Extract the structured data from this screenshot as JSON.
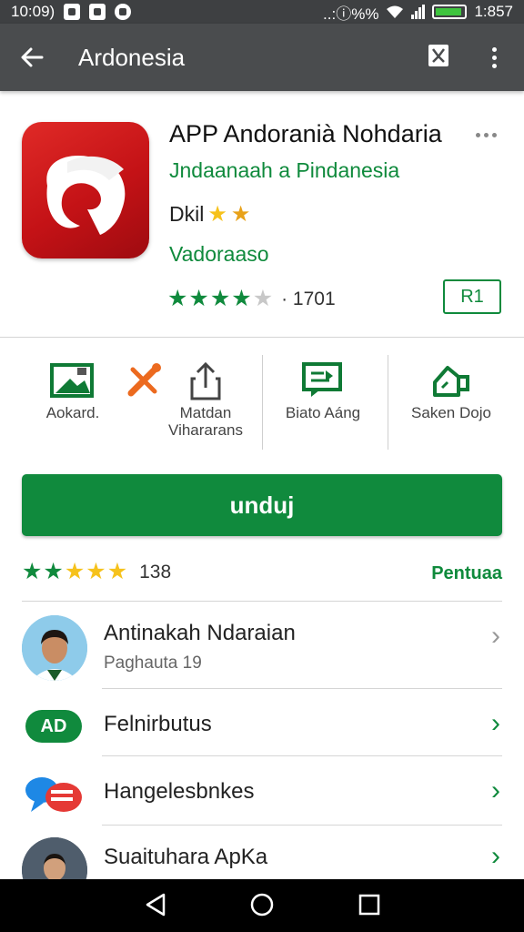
{
  "status_bar": {
    "time_left": "10:09)",
    "indicators": "..:ⓘ%%",
    "time_right": "1:857"
  },
  "app_bar": {
    "title": "Ardonesia",
    "back_icon": "back-arrow-icon",
    "bookmark_icon": "bookmark-icon",
    "more_icon": "more-vertical-icon"
  },
  "app": {
    "name": "APP Andoranià Nohdaria",
    "developer": "Jndaanaah a Pindanesia",
    "content_label": "Dkil",
    "category": "Vadoraaso",
    "rating_stars": 4,
    "rating_count": "· 1701",
    "age_badge": "R1"
  },
  "actions": [
    {
      "label": "Aokard.",
      "icon": "gallery-icon"
    },
    {
      "label": "Matdan\nVihararans",
      "icon": "tools-icon"
    },
    {
      "label": "",
      "icon": "share-icon"
    },
    {
      "label": "Biato Aáng",
      "icon": "message-icon"
    },
    {
      "label": "Saken Dojo",
      "icon": "hand-icon"
    }
  ],
  "install": {
    "label": "unduj"
  },
  "rating_summary": {
    "stars": 5,
    "count": "138",
    "link": "Pentuaa"
  },
  "list": [
    {
      "title": "Antinakah Ndaraian",
      "subtitle": "Paghauta 19",
      "icon": "person-avatar"
    },
    {
      "title": "Felnirbutus",
      "subtitle": "",
      "icon": "ad-badge-icon",
      "badge": "AD"
    },
    {
      "title": "Hangelesbnkes",
      "subtitle": "",
      "icon": "chat-bubbles-icon"
    },
    {
      "title": "Suaituhara ApKa",
      "subtitle": "",
      "icon": "person-avatar"
    }
  ],
  "colors": {
    "accent_green": "#108a3d",
    "app_bar": "#4a4c4e",
    "icon_red": "#c41216",
    "star_gold": "#f6c21c"
  }
}
